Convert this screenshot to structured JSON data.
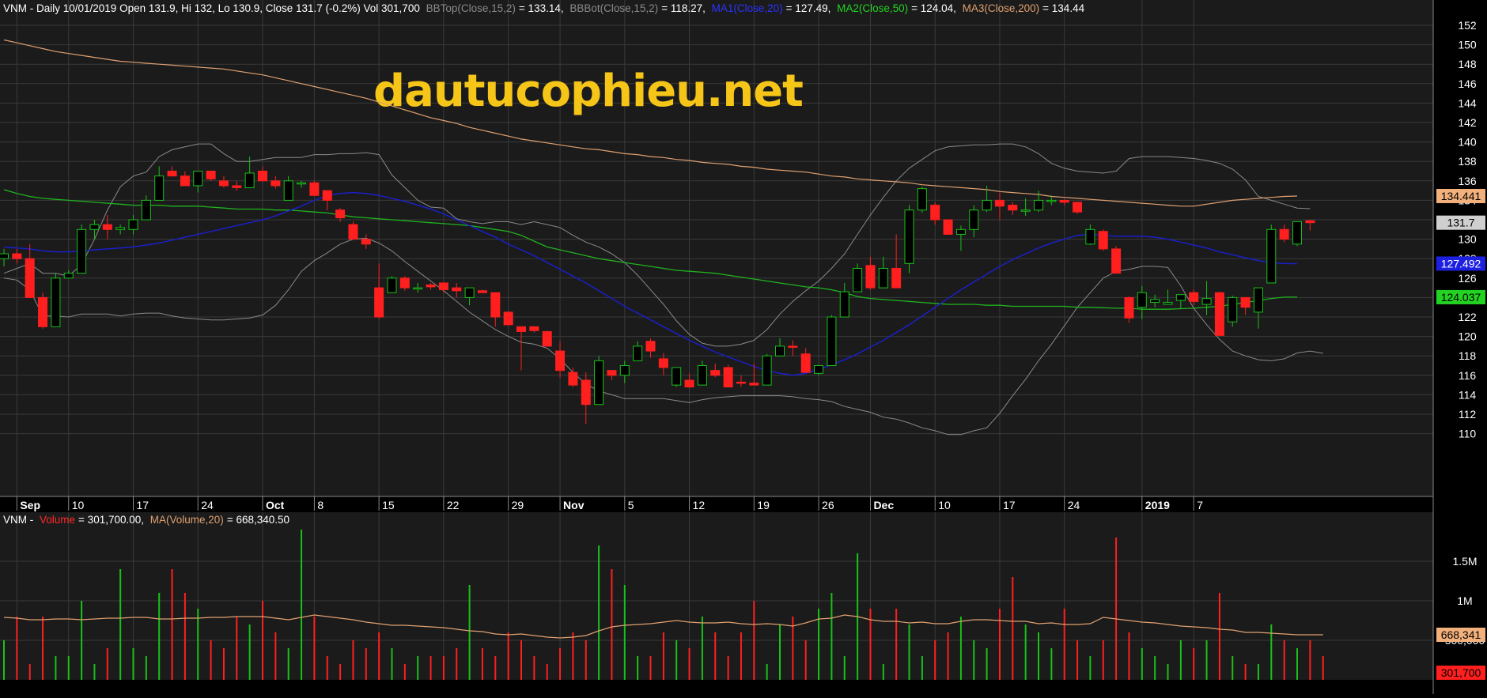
{
  "header": {
    "symbol": "VNM",
    "line": "VNM - Daily 10/01/2019 Open 131.9, Hi 132, Lo 130.9, Close 131.7 (-0.2%) Vol 301,700",
    "bbtop": {
      "label": "BBTop(Close,15,2)",
      "value": "= 133.14,"
    },
    "bbbot": {
      "label": "BBBot(Close,15,2)",
      "value": "= 118.27,"
    },
    "ma1": {
      "label": "MA1(Close,20)",
      "value": "= 127.49,"
    },
    "ma2": {
      "label": "MA2(Close,50)",
      "value": "= 124.04,"
    },
    "ma3": {
      "label": "MA3(Close,200)",
      "value": "= 134.44"
    }
  },
  "watermark": "dautucophieu.net",
  "volume_header": {
    "prefix": "VNM -",
    "volume_label": "Volume",
    "volume_value": "= 301,700.00,",
    "ma_label": "MA(Volume,20)",
    "ma_value": "= 668,340.50"
  },
  "price_badges": {
    "ma3": "134.441",
    "last": "131.7",
    "ma1": "127.492",
    "ma2": "124.037"
  },
  "volume_badges": {
    "ma": "668,341",
    "last": "301,700"
  },
  "colors": {
    "up": "#19c119",
    "down": "#ff1f1f",
    "bb": "#8a8a8a",
    "ma1": "#1a1fc8",
    "ma2": "#1fb31f",
    "ma3": "#e0a070",
    "grid": "#3a3a3a",
    "bg": "#1b1b1b",
    "watermark": "#f5c518",
    "vol_ma": "#e0a070"
  },
  "chart_data": {
    "type": "candlestick",
    "x_ticks": [
      "Sep",
      "10",
      "17",
      "24",
      "Oct",
      "8",
      "15",
      "22",
      "29",
      "Nov",
      "5",
      "12",
      "19",
      "26",
      "Dec",
      "10",
      "17",
      "24",
      "2019",
      "7"
    ],
    "y_ticks": [
      110,
      112,
      114,
      116,
      118,
      120,
      122,
      124,
      126,
      128,
      130,
      132,
      134,
      136,
      138,
      140,
      142,
      144,
      146,
      148,
      150,
      152
    ],
    "ylim": [
      109.5,
      152
    ],
    "volume_ticks": [
      "500,000",
      "1M",
      "1.5M"
    ],
    "candles": [
      [
        128,
        129,
        127.2,
        128.5
      ],
      [
        128.5,
        129,
        127.5,
        128
      ],
      [
        128,
        129.5,
        127,
        124
      ],
      [
        124,
        124.5,
        120.8,
        121
      ],
      [
        121,
        126.5,
        121,
        126
      ],
      [
        126,
        126.8,
        126,
        126.5
      ],
      [
        126.5,
        131.5,
        126.5,
        131
      ],
      [
        131,
        132,
        130,
        131.5
      ],
      [
        131.5,
        132.5,
        130,
        131
      ],
      [
        131,
        131.5,
        130.5,
        131.2
      ],
      [
        131,
        132.5,
        130.5,
        132
      ],
      [
        132,
        134.5,
        132,
        134
      ],
      [
        134,
        137.5,
        134,
        136.5
      ],
      [
        137,
        137.5,
        136.5,
        136.5
      ],
      [
        136.5,
        137,
        135.5,
        135.5
      ],
      [
        135.5,
        137,
        134.8,
        137
      ],
      [
        137,
        137,
        136,
        136.2
      ],
      [
        136,
        136.5,
        135.3,
        135.5
      ],
      [
        135.5,
        136,
        135,
        135.3
      ],
      [
        135.3,
        138.5,
        135.3,
        136.8
      ],
      [
        137,
        137.5,
        136,
        136
      ],
      [
        136,
        136.5,
        135.2,
        135.5
      ],
      [
        134,
        136.5,
        134,
        136
      ],
      [
        135.8,
        136,
        135.3,
        135.8
      ],
      [
        135.8,
        136,
        134.5,
        134.5
      ],
      [
        135,
        135,
        133,
        134
      ],
      [
        133,
        133.2,
        131.8,
        132.2
      ],
      [
        131.5,
        131.8,
        130,
        130
      ],
      [
        130,
        130.5,
        129,
        129.5
      ],
      [
        125,
        127.5,
        121.8,
        122
      ],
      [
        124.5,
        126.2,
        124.5,
        126
      ],
      [
        126,
        126.2,
        124.7,
        125
      ],
      [
        125,
        125.5,
        124.5,
        125
      ],
      [
        125.3,
        125.5,
        124.8,
        125.1
      ],
      [
        125.5,
        125.5,
        124.5,
        124.8
      ],
      [
        125,
        125.5,
        124,
        124.7
      ],
      [
        124,
        125,
        123.2,
        125
      ],
      [
        124.7,
        124.8,
        124.5,
        124.5
      ],
      [
        124.5,
        124.5,
        121,
        122
      ],
      [
        122.5,
        122.5,
        121.2,
        121.2
      ],
      [
        121,
        121,
        116.5,
        120.5
      ],
      [
        121,
        121,
        120.4,
        120.6
      ],
      [
        120.5,
        120.6,
        119,
        119
      ],
      [
        118.5,
        119.5,
        115.8,
        116.5
      ],
      [
        116.3,
        116.8,
        114.8,
        115
      ],
      [
        115.5,
        116.3,
        111,
        113
      ],
      [
        113,
        118,
        113,
        117.5
      ],
      [
        116.5,
        116.5,
        115.5,
        116
      ],
      [
        116,
        117.5,
        115.2,
        117
      ],
      [
        117.5,
        119.5,
        117.5,
        119
      ],
      [
        119.5,
        119.8,
        117.8,
        118.5
      ],
      [
        117.7,
        118.3,
        116,
        116.8
      ],
      [
        115,
        116.8,
        114.8,
        116.8
      ],
      [
        115.5,
        116.2,
        114.7,
        114.8
      ],
      [
        115,
        117.5,
        115,
        117
      ],
      [
        116.5,
        117.2,
        115.8,
        116
      ],
      [
        116.8,
        117.1,
        114.8,
        114.8
      ],
      [
        115.3,
        116,
        114.8,
        115.2
      ],
      [
        115.2,
        117.2,
        115,
        115
      ],
      [
        115,
        118.2,
        115,
        118
      ],
      [
        118,
        119.8,
        118,
        119
      ],
      [
        119,
        119.6,
        118,
        118.9
      ],
      [
        118.2,
        118.8,
        116.6,
        116.3
      ],
      [
        116.2,
        117,
        116,
        117
      ],
      [
        117,
        122.2,
        117,
        122
      ],
      [
        122,
        125.5,
        122,
        124.6
      ],
      [
        124.6,
        127.5,
        124.6,
        127
      ],
      [
        127.3,
        128.2,
        124.8,
        125
      ],
      [
        125,
        128.2,
        125,
        127
      ],
      [
        127,
        130.5,
        125,
        125
      ],
      [
        127.5,
        133.5,
        126.5,
        133
      ],
      [
        133,
        135.4,
        132.7,
        135.2
      ],
      [
        133.5,
        133.8,
        131.5,
        132
      ],
      [
        132,
        132,
        130.5,
        130.5
      ],
      [
        130.5,
        131.4,
        128.8,
        131
      ],
      [
        131,
        133.5,
        130.2,
        133
      ],
      [
        133,
        135.5,
        132.8,
        134
      ],
      [
        134,
        134.8,
        132,
        133.4
      ],
      [
        133.5,
        133.8,
        132.5,
        133
      ],
      [
        133,
        134.2,
        132.4,
        133
      ],
      [
        133,
        135,
        132.8,
        134
      ],
      [
        134,
        134.5,
        133.5,
        134
      ],
      [
        134,
        134.1,
        133.5,
        133.8
      ],
      [
        133.8,
        133.8,
        132.6,
        132.8
      ],
      [
        129.5,
        131.5,
        129.4,
        131
      ],
      [
        130.8,
        131,
        128.8,
        129
      ],
      [
        129,
        129.3,
        126.5,
        126.5
      ],
      [
        124,
        124.1,
        121.4,
        121.9
      ],
      [
        123,
        125.2,
        121.8,
        124.5
      ],
      [
        123.5,
        124.3,
        123,
        123.8
      ],
      [
        123.3,
        124.8,
        123.3,
        123.5
      ],
      [
        123.7,
        124.2,
        122.8,
        124.3
      ],
      [
        124.5,
        124.8,
        123.2,
        123.6
      ],
      [
        123.3,
        125.7,
        122.2,
        123.9
      ],
      [
        124.5,
        124.6,
        121.2,
        120.1
      ],
      [
        121.5,
        124.2,
        121,
        124
      ],
      [
        124,
        124,
        122.2,
        123
      ],
      [
        122.5,
        125,
        120.8,
        125
      ],
      [
        125.5,
        131.5,
        125.5,
        131
      ],
      [
        131,
        131.5,
        129.7,
        130
      ],
      [
        129.5,
        131.8,
        129.3,
        131.8
      ],
      [
        131.9,
        132,
        130.9,
        131.7
      ]
    ],
    "bb_top": [
      126.5,
      127,
      127.5,
      126.5,
      126.5,
      126.2,
      127.4,
      130,
      133,
      135.4,
      136.5,
      136.9,
      138.5,
      139.2,
      139.5,
      139.8,
      139.8,
      138.8,
      138,
      138,
      138.2,
      138.4,
      138.4,
      138.4,
      138.7,
      138.7,
      138.8,
      138.8,
      138.9,
      138.7,
      136.6,
      135.3,
      134,
      133.3,
      133.2,
      132.1,
      131.8,
      131.6,
      131.8,
      131.8,
      131.5,
      131.8,
      131.5,
      131.2,
      130.4,
      129.7,
      129.2,
      128.5,
      127.6,
      126.3,
      124.8,
      123.3,
      121.6,
      120.2,
      119.3,
      119,
      119,
      119.2,
      119.6,
      120.7,
      122.3,
      123.6,
      124.7,
      125.7,
      127,
      128.5,
      130.5,
      132.5,
      134.3,
      136,
      137.3,
      138.2,
      139.1,
      139.5,
      139.6,
      139.7,
      139.7,
      139.8,
      139.8,
      139.5,
      138.8,
      137.8,
      137.3,
      137,
      136.9,
      136.8,
      137,
      138.3,
      138.5,
      138.5,
      138.5,
      138.4,
      138.3,
      138.1,
      137.8,
      137.2,
      136.1,
      134.4,
      134,
      133.6,
      133.2,
      133.14
    ],
    "bb_bot": [
      126,
      125.8,
      124.8,
      122.1,
      122.1,
      122,
      122.3,
      122.3,
      122.3,
      122.1,
      122.3,
      122.4,
      122.4,
      122.1,
      121.9,
      121.8,
      121.7,
      121.7,
      121.8,
      121.9,
      122.2,
      123.2,
      124.8,
      126.7,
      127.8,
      128.6,
      129.5,
      130,
      130.1,
      129.6,
      128.8,
      127.7,
      126.7,
      125.7,
      124.7,
      123.6,
      122.5,
      121.6,
      120.7,
      120,
      119.4,
      119.2,
      118.8,
      117.7,
      116.3,
      115.1,
      114.4,
      114,
      113.6,
      113.6,
      113.6,
      113.6,
      113.4,
      113.2,
      113.5,
      113.7,
      113.8,
      113.9,
      113.9,
      113.9,
      113.9,
      113.8,
      113.6,
      113.5,
      113.3,
      112.8,
      112.5,
      112.2,
      111.7,
      111.5,
      111.1,
      110.6,
      110.3,
      109.9,
      109.9,
      110.3,
      110.6,
      112.1,
      113.9,
      115.6,
      117.5,
      119.2,
      121.1,
      123,
      124.5,
      126,
      126.7,
      126.9,
      127.2,
      127.2,
      127.1,
      125.2,
      122.9,
      121.2,
      119.7,
      118.5,
      118,
      117.6,
      117.5,
      117.7,
      118.3,
      118.5,
      118.27
    ],
    "ma1": [
      129.2,
      129.1,
      129,
      128.8,
      128.7,
      128.7,
      128.8,
      128.9,
      129,
      129.1,
      129.2,
      129.4,
      129.6,
      129.9,
      130.2,
      130.5,
      130.8,
      131.1,
      131.4,
      131.7,
      132,
      132.4,
      132.9,
      133.4,
      134,
      134.5,
      134.7,
      134.8,
      134.7,
      134.5,
      134.2,
      133.9,
      133.5,
      133.1,
      132.6,
      132,
      131.4,
      130.8,
      130.2,
      129.5,
      128.9,
      128.3,
      127.6,
      126.9,
      126.2,
      125.5,
      124.7,
      123.9,
      123.1,
      122.4,
      121.7,
      121,
      120.3,
      119.6,
      119,
      118.4,
      117.9,
      117.4,
      116.9,
      116.5,
      116.2,
      116,
      116.2,
      116.6,
      117.1,
      117.6,
      118.2,
      118.9,
      119.6,
      120.4,
      121.2,
      122.1,
      123,
      123.9,
      124.8,
      125.6,
      126.4,
      127.2,
      127.9,
      128.5,
      129.1,
      129.6,
      130,
      130.4,
      130.5,
      130.4,
      130.3,
      130.3,
      130.3,
      130.2,
      130,
      129.7,
      129.4,
      129.1,
      128.7,
      128.4,
      128.1,
      127.8,
      127.6,
      127.5,
      127.49
    ],
    "ma2": [
      135.1,
      134.7,
      134.4,
      134.2,
      134.1,
      134,
      133.9,
      133.8,
      133.7,
      133.6,
      133.5,
      133.5,
      133.5,
      133.4,
      133.4,
      133.4,
      133.3,
      133.2,
      133.1,
      133.1,
      133.1,
      133,
      133,
      132.9,
      132.8,
      132.7,
      132.5,
      132.3,
      132.2,
      132.1,
      132,
      131.9,
      131.8,
      131.7,
      131.6,
      131.5,
      131.4,
      131.2,
      131,
      130.8,
      130.4,
      129.8,
      129.2,
      128.9,
      128.6,
      128.3,
      128,
      127.8,
      127.6,
      127.4,
      127.2,
      127,
      126.8,
      126.7,
      126.6,
      126.5,
      126.3,
      126.1,
      125.9,
      125.7,
      125.5,
      125.3,
      125.1,
      125,
      124.8,
      124.5,
      124.1,
      123.9,
      123.8,
      123.7,
      123.6,
      123.5,
      123.4,
      123.3,
      123.3,
      123.3,
      123.2,
      123.2,
      123.1,
      123.1,
      123.1,
      123.1,
      123.1,
      123,
      123,
      122.95,
      122.9,
      122.9,
      122.8,
      122.8,
      122.8,
      122.85,
      122.9,
      123,
      123.1,
      123.3,
      123.5,
      123.7,
      123.9,
      124.04,
      124.04
    ],
    "ma3": [
      150.5,
      150.2,
      149.9,
      149.6,
      149.3,
      149.1,
      148.9,
      148.7,
      148.5,
      148.3,
      148.2,
      148.1,
      148,
      147.9,
      147.8,
      147.7,
      147.6,
      147.5,
      147.3,
      147.1,
      146.9,
      146.6,
      146.3,
      146,
      145.7,
      145.4,
      145.1,
      144.8,
      144.5,
      144.1,
      143.7,
      143.3,
      142.9,
      142.5,
      142.2,
      141.9,
      141.5,
      141.2,
      140.9,
      140.6,
      140.3,
      140.1,
      139.9,
      139.7,
      139.5,
      139.3,
      139.2,
      139,
      138.8,
      138.7,
      138.5,
      138.4,
      138.2,
      138.1,
      137.9,
      137.8,
      137.7,
      137.5,
      137.4,
      137.2,
      137.1,
      137,
      136.9,
      136.7,
      136.5,
      136.4,
      136.2,
      136.1,
      136,
      135.9,
      135.8,
      135.6,
      135.5,
      135.4,
      135.3,
      135.2,
      135.1,
      134.9,
      134.8,
      134.7,
      134.6,
      134.4,
      134.3,
      134.2,
      134.1,
      134.0,
      133.9,
      133.8,
      133.7,
      133.6,
      133.5,
      133.4,
      133.4,
      133.6,
      133.8,
      134,
      134.1,
      134.2,
      134.3,
      134.4,
      134.44
    ],
    "volume_scale_max": 2000000,
    "volumes": [
      0.5,
      0.8,
      0.2,
      0.8,
      0.3,
      0.3,
      1.0,
      0.2,
      0.4,
      1.4,
      0.4,
      0.3,
      1.1,
      1.4,
      1.1,
      0.9,
      0.5,
      0.4,
      0.8,
      0.7,
      1.0,
      0.6,
      0.4,
      1.9,
      0.8,
      0.3,
      0.2,
      0.5,
      0.4,
      0.6,
      0.4,
      0.2,
      0.3,
      0.3,
      0.3,
      0.4,
      1.2,
      0.4,
      0.3,
      0.6,
      0.5,
      0.3,
      0.2,
      0.4,
      0.6,
      0.5,
      1.7,
      1.4,
      1.2,
      0.3,
      0.3,
      0.6,
      0.5,
      0.4,
      0.8,
      0.6,
      0.3,
      0.6,
      1.0,
      0.2,
      0.7,
      0.8,
      0.5,
      0.9,
      1.1,
      0.3,
      1.6,
      0.9,
      0.2,
      0.9,
      0.7,
      0.3,
      0.5,
      0.6,
      0.8,
      0.5,
      0.4,
      0.9,
      1.3,
      0.7,
      0.6,
      0.4,
      0.9,
      0.5,
      0.3,
      0.5,
      1.8,
      0.6,
      0.4,
      0.3,
      0.2,
      0.5,
      0.4,
      0.5,
      1.1,
      0.3,
      0.2,
      0.2,
      0.7,
      0.5,
      0.4,
      0.5,
      0.3
    ],
    "volume_ma": [
      0.79,
      0.78,
      0.76,
      0.76,
      0.77,
      0.77,
      0.76,
      0.77,
      0.78,
      0.78,
      0.79,
      0.79,
      0.77,
      0.77,
      0.78,
      0.78,
      0.79,
      0.79,
      0.8,
      0.8,
      0.8,
      0.78,
      0.76,
      0.79,
      0.82,
      0.8,
      0.78,
      0.76,
      0.73,
      0.71,
      0.69,
      0.69,
      0.68,
      0.67,
      0.66,
      0.64,
      0.62,
      0.61,
      0.58,
      0.57,
      0.58,
      0.56,
      0.54,
      0.53,
      0.54,
      0.56,
      0.62,
      0.67,
      0.69,
      0.7,
      0.71,
      0.73,
      0.75,
      0.73,
      0.72,
      0.72,
      0.73,
      0.71,
      0.7,
      0.71,
      0.7,
      0.68,
      0.72,
      0.77,
      0.78,
      0.82,
      0.8,
      0.76,
      0.74,
      0.74,
      0.72,
      0.73,
      0.71,
      0.71,
      0.74,
      0.76,
      0.76,
      0.75,
      0.74,
      0.74,
      0.71,
      0.72,
      0.7,
      0.7,
      0.71,
      0.79,
      0.77,
      0.75,
      0.73,
      0.72,
      0.7,
      0.68,
      0.67,
      0.66,
      0.64,
      0.63,
      0.6,
      0.6,
      0.59,
      0.58,
      0.57,
      0.57,
      0.57
    ]
  }
}
